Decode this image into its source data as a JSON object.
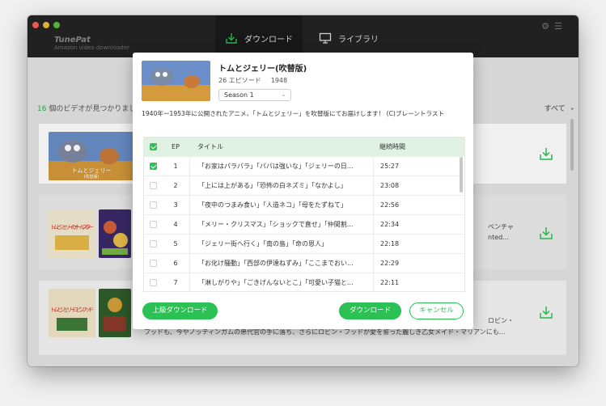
{
  "app": {
    "name": "TunePat",
    "subtitle": "Amazon video downloader"
  },
  "tabs": [
    {
      "label": "ダウンロード",
      "icon": "download-icon",
      "active": true
    },
    {
      "label": "ライブラリ",
      "icon": "monitor-icon",
      "active": false
    }
  ],
  "list": {
    "found_count": "16",
    "found_suffix": " 個のビデオが見つかりました",
    "filter_label": "すべて",
    "filter_icon": "caret-down-icon",
    "rows": [
      {
        "thumb_label": "トムとジェリー",
        "thumb_sub": "(吹替版)",
        "text_line1": "",
        "text_line2": ""
      },
      {
        "thumb_label": "トムとジェリーのオールスター",
        "thumb_sub": "",
        "text_line1": "ベンチャ",
        "text_line2": "nted..."
      },
      {
        "thumb_label": "トムとジェリー ロビン フッド",
        "thumb_sub": "",
        "text_line1": "ロビン・",
        "text_line2": "フッドも、今やノッティンガムの悪代官の手に落ち、さらにロビン・フッドが愛を誓った麗しき乙女メイド・マリアンにも..."
      }
    ]
  },
  "modal": {
    "title": "トムとジェリー(吹替版)",
    "episodes": "26 エピソード",
    "year": "1948",
    "season": "Season 1",
    "description": "1940年ー1953年に公開されたアニメ、「トムとジェリー」を吹替版にてお届けします！ (C)ブレーントラスト",
    "table": {
      "headers": {
        "ep": "EP",
        "title": "タイトル",
        "duration": "継続時間"
      },
      "rows": [
        {
          "checked": true,
          "ep": "1",
          "title": "「お家はパラパラ」「パパは強いな」「ジェリーの日...",
          "duration": "25:27"
        },
        {
          "checked": false,
          "ep": "2",
          "title": "「上には上がある」「恐怖の白ネズミ」「なかよし」",
          "duration": "23:08"
        },
        {
          "checked": false,
          "ep": "3",
          "title": "「夜中のつまみ食い」「人造ネコ」「母をたずねて」",
          "duration": "22:56"
        },
        {
          "checked": false,
          "ep": "4",
          "title": "「メリー・クリスマス」「ショックで直せ」「仲間割...",
          "duration": "22:34"
        },
        {
          "checked": false,
          "ep": "5",
          "title": "「ジェリー街へ行く」「南の島」「命の恩人」",
          "duration": "22:18"
        },
        {
          "checked": false,
          "ep": "6",
          "title": "「お化け騒動」「西部の伊達ねずみ」「ここまでおい...",
          "duration": "22:29"
        },
        {
          "checked": false,
          "ep": "7",
          "title": "「淋しがりや」「ごきげんないとこ」「可愛い子猫と...",
          "duration": "22:11"
        }
      ]
    },
    "buttons": {
      "advanced": "上級ダウンロード",
      "download": "ダウンロード",
      "cancel": "キャンセル"
    }
  },
  "colors": {
    "accent": "#2bc154",
    "titlebar": "#242424",
    "table_header": "#dff2e4"
  }
}
